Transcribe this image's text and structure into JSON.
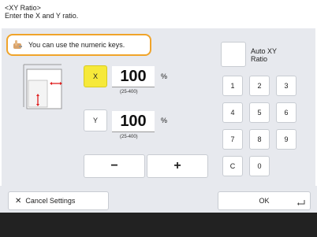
{
  "header": {
    "title": "<XY Ratio>",
    "subtitle": "Enter the X and Y ratio."
  },
  "hint": {
    "text": "You can use the numeric keys."
  },
  "x": {
    "label": "X",
    "value": "100",
    "unit": "%",
    "range": "(25-400)"
  },
  "y": {
    "label": "Y",
    "value": "100",
    "unit": "%",
    "range": "(25-400)"
  },
  "adjust": {
    "minus": "−",
    "plus": "+"
  },
  "auto": {
    "label_line1": "Auto XY",
    "label_line2": "Ratio"
  },
  "keypad": {
    "k1": "1",
    "k2": "2",
    "k3": "3",
    "k4": "4",
    "k5": "5",
    "k6": "6",
    "k7": "7",
    "k8": "8",
    "k9": "9",
    "kc": "C",
    "k0": "0"
  },
  "footer": {
    "cancel_label": "Cancel Settings",
    "ok_label": "OK"
  },
  "colors": {
    "accent_yellow": "#f6e93a",
    "hint_border": "#f0a42a",
    "panel": "#e7e9ee"
  }
}
